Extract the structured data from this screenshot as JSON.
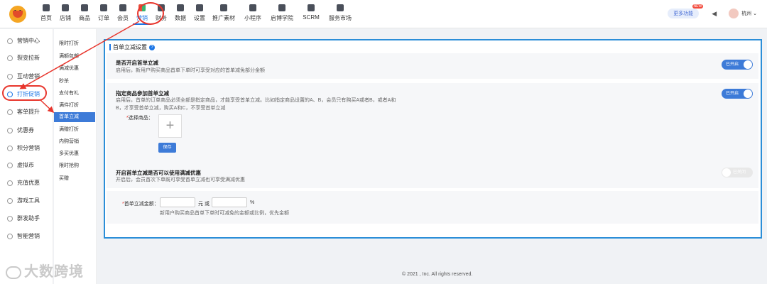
{
  "nav": {
    "items": [
      "首页",
      "店铺",
      "商品",
      "订单",
      "会员",
      "营销",
      "财务",
      "数据",
      "设置",
      "推广素材",
      "小程序",
      "启博学院",
      "SCRM",
      "服务市场"
    ],
    "active_index": 5
  },
  "header": {
    "more_features": "更多功能",
    "new_badge": "NEW",
    "city": "杭州"
  },
  "sidebar": {
    "items": [
      "营销中心",
      "裂变拉新",
      "互动营销",
      "打折促销",
      "客单提升",
      "优惠券",
      "积分营销",
      "虚拟币",
      "充值优惠",
      "游戏工具",
      "群发助手",
      "智能营销"
    ],
    "active_index": 3
  },
  "subnav": {
    "items": [
      "限时打折",
      "满额包邮",
      "满减优惠",
      "秒杀",
      "支付有礼",
      "满件打折",
      "首单立减",
      "满赠打折",
      "内购营销",
      "多买优惠",
      "限时抢购",
      "买赠"
    ],
    "active_index": 6
  },
  "panel": {
    "title": "首单立减设置",
    "section1": {
      "title": "是否开启首单立减",
      "desc": "启用后，新用户购买商品首单下单时可享受对应的首单减免部分金额",
      "toggle": "已开启"
    },
    "section2": {
      "title": "指定商品参加首单立减",
      "desc_line1": "启用后，首单的订单商品必须全部是指定商品，才能享受首单立减。比如指定商品设置的A、B，会员只有购买A或者B，或者A和",
      "desc_line2": "B，才享受首单立减，购买A和C，不享受首单立减",
      "toggle": "已开启",
      "select_label": "选择商品：",
      "save_label": "保存"
    },
    "section3": {
      "title": "开启首单立减是否可以使用满减优惠",
      "desc": "开启后，会员首次下单既可享受首单立减也可享受满减优惠",
      "toggle": "已关闭"
    },
    "section4": {
      "amount_label": "首单立减金额：",
      "unit_yuan": "元",
      "or": "或",
      "unit_percent": "%",
      "hint": "新用户购买商品首单下单时可减免的金额或比例，优先金额"
    }
  },
  "footer": "© 2021 , Inc. All rights reserved.",
  "watermark": "大数跨境",
  "colors": {
    "accent": "#3d7bd8",
    "annotation": "#e8352c",
    "panel_border": "#2b8ed8"
  }
}
